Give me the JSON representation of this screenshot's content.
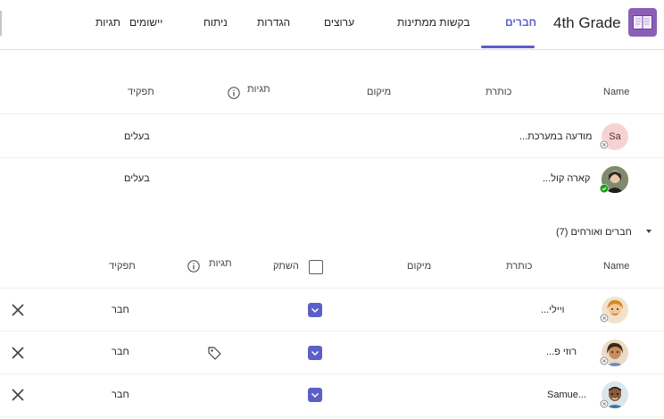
{
  "header": {
    "team_name": "4th Grade",
    "tabs": [
      {
        "label": "חברים"
      },
      {
        "label": "בקשות ממתינות"
      },
      {
        "label": "ערוצים"
      },
      {
        "label": "הגדרות"
      },
      {
        "label": "ניתוח"
      },
      {
        "label": "יישומים"
      },
      {
        "label": "תגיות"
      }
    ]
  },
  "owners": {
    "columns": {
      "name": "Name",
      "title": "כותרת",
      "location": "מיקום",
      "tags": "תגיות",
      "role": "תפקיד"
    },
    "rows": [
      {
        "initials": "Sa",
        "name": "מודעה במערכת...",
        "role": "בעלים"
      },
      {
        "name": "קארה קול...",
        "role": "בעלים"
      }
    ]
  },
  "members": {
    "section_label": "חברים ואורחים (7)",
    "columns": {
      "name": "Name",
      "title": "כותרת",
      "location": "מיקום",
      "mute": "השתק",
      "tags": "תגיות",
      "role": "תפקיד"
    },
    "rows": [
      {
        "name": "ויילי...",
        "role": "חבר"
      },
      {
        "name": "רוזי פ...",
        "role": "חבר"
      },
      {
        "name": "Samue...",
        "role": "חבר"
      }
    ]
  },
  "colors": {
    "accent": "#5b5fc7",
    "app_icon": "#8b5fb6",
    "presence_available": "#13a10e"
  },
  "icons": [
    "book-icon",
    "info-icon",
    "chevron-down-icon",
    "tag-icon",
    "close-icon",
    "offline-status-icon",
    "available-status-icon"
  ]
}
